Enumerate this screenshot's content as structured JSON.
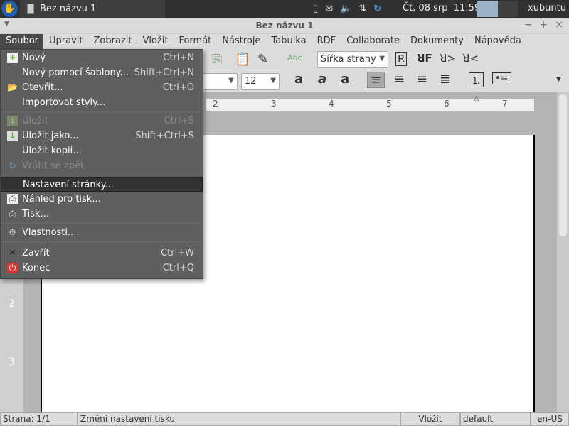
{
  "panel": {
    "task_title": "Bez názvu 1",
    "clock": "Čt, 08 srp  11:59",
    "user": "xubuntu",
    "tray_icons": [
      "battery-icon",
      "mail-icon",
      "volume-icon",
      "network-icon",
      "update-icon"
    ]
  },
  "window": {
    "title": "Bez názvu 1"
  },
  "menubar": [
    "Soubor",
    "Upravit",
    "Zobrazit",
    "Vložit",
    "Formát",
    "Nástroje",
    "Tabulka",
    "RDF",
    "Collaborate",
    "Dokumenty",
    "Nápověda"
  ],
  "toolbar": {
    "zoom_value": "Šířka strany",
    "font_size": "12"
  },
  "ruler": {
    "h_ticks": [
      "2",
      "3",
      "4",
      "5",
      "6",
      "7"
    ],
    "v_ticks": [
      "2",
      "3"
    ]
  },
  "file_menu": [
    {
      "label": "Nový",
      "shortcut": "Ctrl+N",
      "icon": "new-document-icon"
    },
    {
      "label": "Nový pomocí šablony...",
      "shortcut": "Shift+Ctrl+N"
    },
    {
      "label": "Otevřít...",
      "shortcut": "Ctrl+O",
      "icon": "open-folder-icon"
    },
    {
      "label": "Importovat styly...",
      "shortcut": ""
    },
    {
      "label": "Uložit",
      "shortcut": "Ctrl+S",
      "icon": "save-icon",
      "disabled": true
    },
    {
      "label": "Uložit jako...",
      "shortcut": "Shift+Ctrl+S",
      "icon": "save-as-icon"
    },
    {
      "label": "Uložit kopii...",
      "shortcut": ""
    },
    {
      "label": "Vrátit se zpět",
      "shortcut": "",
      "icon": "revert-icon",
      "disabled": true
    },
    {
      "label": "Nastavení stránky...",
      "shortcut": "",
      "highlighted": true
    },
    {
      "label": "Náhled pro tisk...",
      "shortcut": "",
      "icon": "print-preview-icon"
    },
    {
      "label": "Tisk...",
      "shortcut": "",
      "icon": "print-icon"
    },
    {
      "label": "Vlastnosti...",
      "shortcut": "",
      "icon": "gear-icon"
    },
    {
      "label": "Zavřít",
      "shortcut": "Ctrl+W",
      "icon": "close-icon"
    },
    {
      "label": "Konec",
      "shortcut": "Ctrl+Q",
      "icon": "power-icon"
    }
  ],
  "status": {
    "page": "Strana: 1/1",
    "message": "Změní nastavení tisku",
    "mode": "Vložit",
    "style": "default",
    "language": "en-US"
  }
}
